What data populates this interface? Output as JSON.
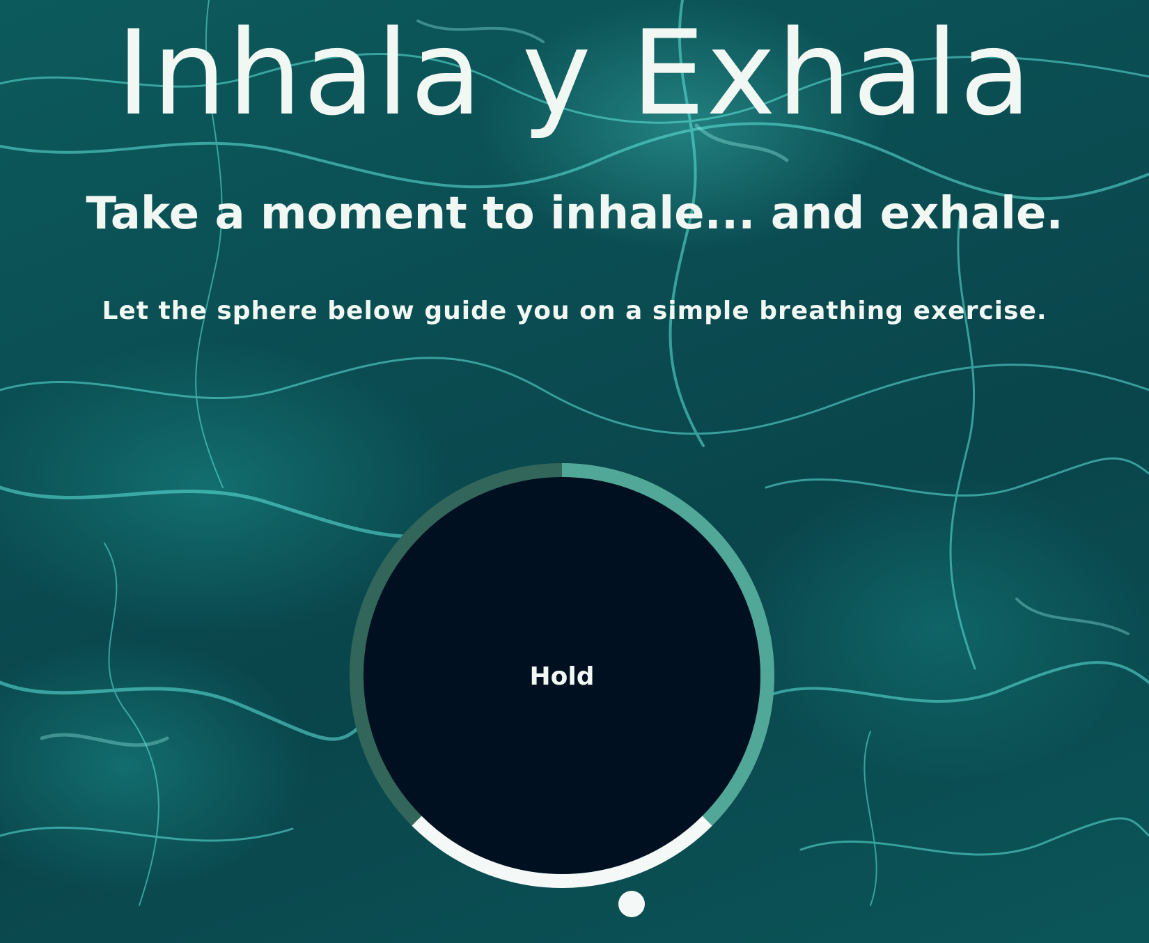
{
  "header": {
    "title": "Inhala y Exhala",
    "subtitle": "Take a moment to inhale... and exhale.",
    "lead": "Let the sphere below guide you on a simple breathing exercise."
  },
  "breathing": {
    "status": "Hold",
    "ring_colors": {
      "inhale": "#52a898",
      "hold": "#f4f8f6",
      "exhale": "#33665a"
    },
    "sphere_color": "#011020"
  },
  "colors": {
    "text": "#f1f7f2",
    "background": "#0a4d52"
  }
}
